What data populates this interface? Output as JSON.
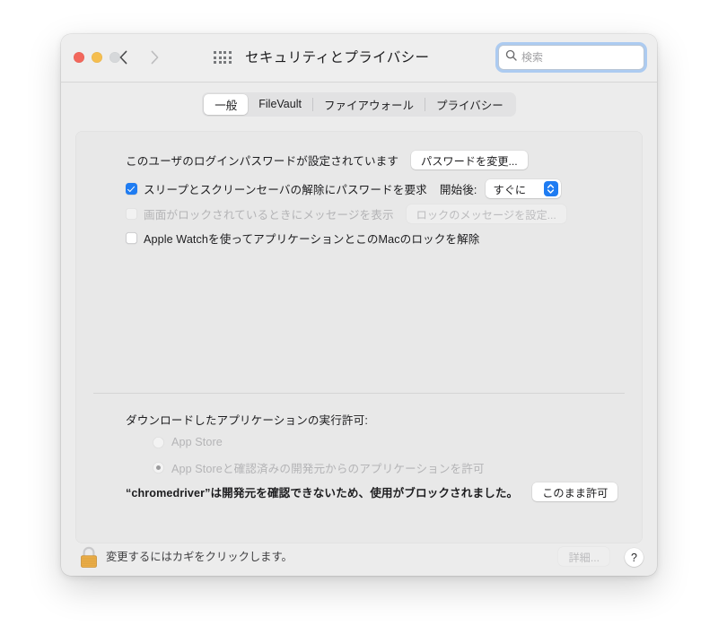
{
  "window": {
    "title": "セキュリティとプライバシー",
    "traffic_lights": [
      "close-red",
      "minimize-yellow",
      "zoom-gray-disabled"
    ],
    "back_label": "‹",
    "forward_label": "›",
    "grid_icon": "show-all-grid-icon"
  },
  "search": {
    "placeholder": "検索",
    "value": "",
    "icon": "search-icon",
    "focused": true
  },
  "tabs": [
    {
      "label": "一般",
      "selected": true
    },
    {
      "label": "FileVault",
      "selected": false
    },
    {
      "label": "ファイアウォール",
      "selected": false
    },
    {
      "label": "プライバシー",
      "selected": false
    }
  ],
  "general": {
    "password_status": "このユーザのログインパスワードが設定されています",
    "change_password_button": "パスワードを変更...",
    "require_password": {
      "label": "スリープとスクリーンセーバの解除にパスワードを要求",
      "checked": true,
      "enabled": true
    },
    "delay": {
      "label": "開始後:",
      "value": "すぐに"
    },
    "show_message": {
      "label": "画面がロックされているときにメッセージを表示",
      "checked": false,
      "enabled": false
    },
    "set_lock_message_button": {
      "label": "ロックのメッセージを設定...",
      "enabled": false
    },
    "apple_watch": {
      "label": "Apple Watchを使ってアプリケーションとこのMacのロックを解除",
      "checked": false,
      "enabled": true
    }
  },
  "downloads": {
    "heading": "ダウンロードしたアプリケーションの実行許可:",
    "options": [
      {
        "label": "App Store",
        "selected": false,
        "enabled": false
      },
      {
        "label": "App Storeと確認済みの開発元からのアプリケーションを許可",
        "selected": true,
        "enabled": false
      }
    ],
    "blocked_notice": "“chromedriver”は開発元を確認できないため、使用がブロックされました。",
    "allow_anyway_button": "このまま許可"
  },
  "footer": {
    "lock_icon": "closed-padlock-icon",
    "lock_text": "変更するにはカギをクリックします。",
    "advanced_button": {
      "label": "詳細...",
      "enabled": false
    },
    "help_button": "?"
  },
  "colors": {
    "accent_blue": "#1f7cf2",
    "window_bg": "#ececec",
    "panel_bg": "#e8e8e8",
    "titlebar_bg": "#eeeeee",
    "lock_body": "#f0b14b",
    "text": "#1d1d1f",
    "disabled_text": "#b4b4b6"
  }
}
